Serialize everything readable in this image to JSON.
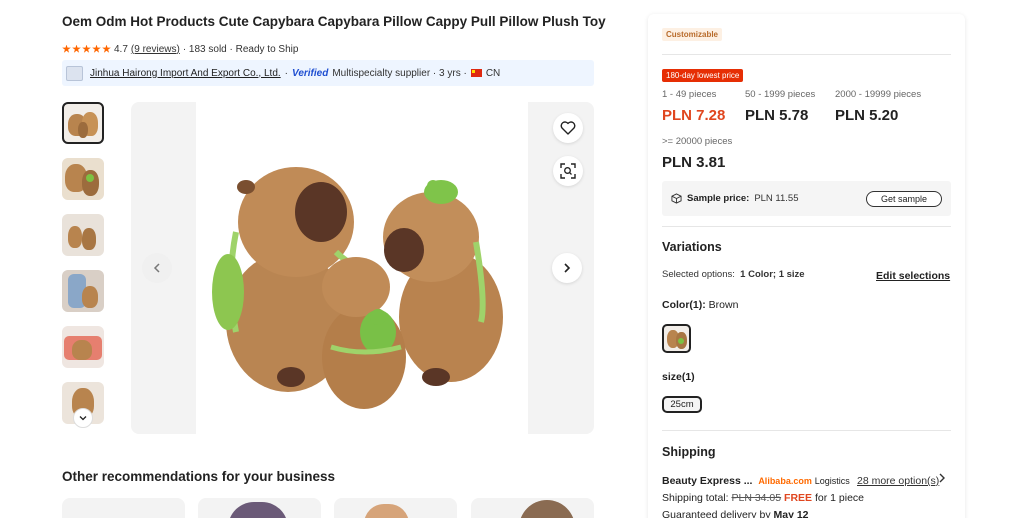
{
  "product": {
    "title": "Oem Odm Hot Products Cute Capybara Capybara Pillow Cappy Pull Pillow Plush Toy",
    "rating": "4.7",
    "reviews": "(9 reviews)",
    "sold": "· 183 sold · Ready to Ship"
  },
  "supplier": {
    "name": "Jinhua Hairong Import And Export Co., Ltd.",
    "verified": "Verified",
    "desc": "Multispecialty supplier · 3 yrs ·",
    "country": "CN"
  },
  "gallery": {
    "thumbnail_count": 6,
    "active_index": 0
  },
  "recommendations": {
    "title": "Other recommendations for your business"
  },
  "panel": {
    "badge": "Customizable",
    "lowest_price": "180-day lowest price",
    "tiers": [
      {
        "qty": "1 - 49 pieces",
        "price": "PLN 7.28"
      },
      {
        "qty": "50 - 1999 pieces",
        "price": "PLN 5.78"
      },
      {
        "qty": "2000 - 19999 pieces",
        "price": "PLN 5.20"
      },
      {
        "qty": ">= 20000 pieces",
        "price": "PLN 3.81"
      }
    ],
    "sample_label": "Sample price:",
    "sample_price": "PLN 11.55",
    "get_sample": "Get sample",
    "variations_title": "Variations",
    "selected_options_label": "Selected options:",
    "selected_options_value": "1 Color; 1 size",
    "edit_selections": "Edit selections",
    "color_label": "Color(1):",
    "color_value": "Brown",
    "size_label": "size(1)",
    "size_value": "25cm",
    "shipping_title": "Shipping",
    "ship_method": "Beauty Express ...",
    "ship_brand": "Alibaba.com",
    "ship_logistics": "Logistics",
    "more_options": "28 more option(s)",
    "ship_total_label": "Shipping total:",
    "ship_total_old": "PLN 34.05",
    "ship_free": "FREE",
    "ship_for": "for 1 piece",
    "guaranteed": "Guaranteed delivery by",
    "guaranteed_date": "May 12"
  },
  "colors": {
    "accent": "#e0461f",
    "alibaba": "#ff6a00",
    "badge_red": "#e62e04",
    "star": "#ff6600",
    "verified": "#1f4fd1"
  }
}
